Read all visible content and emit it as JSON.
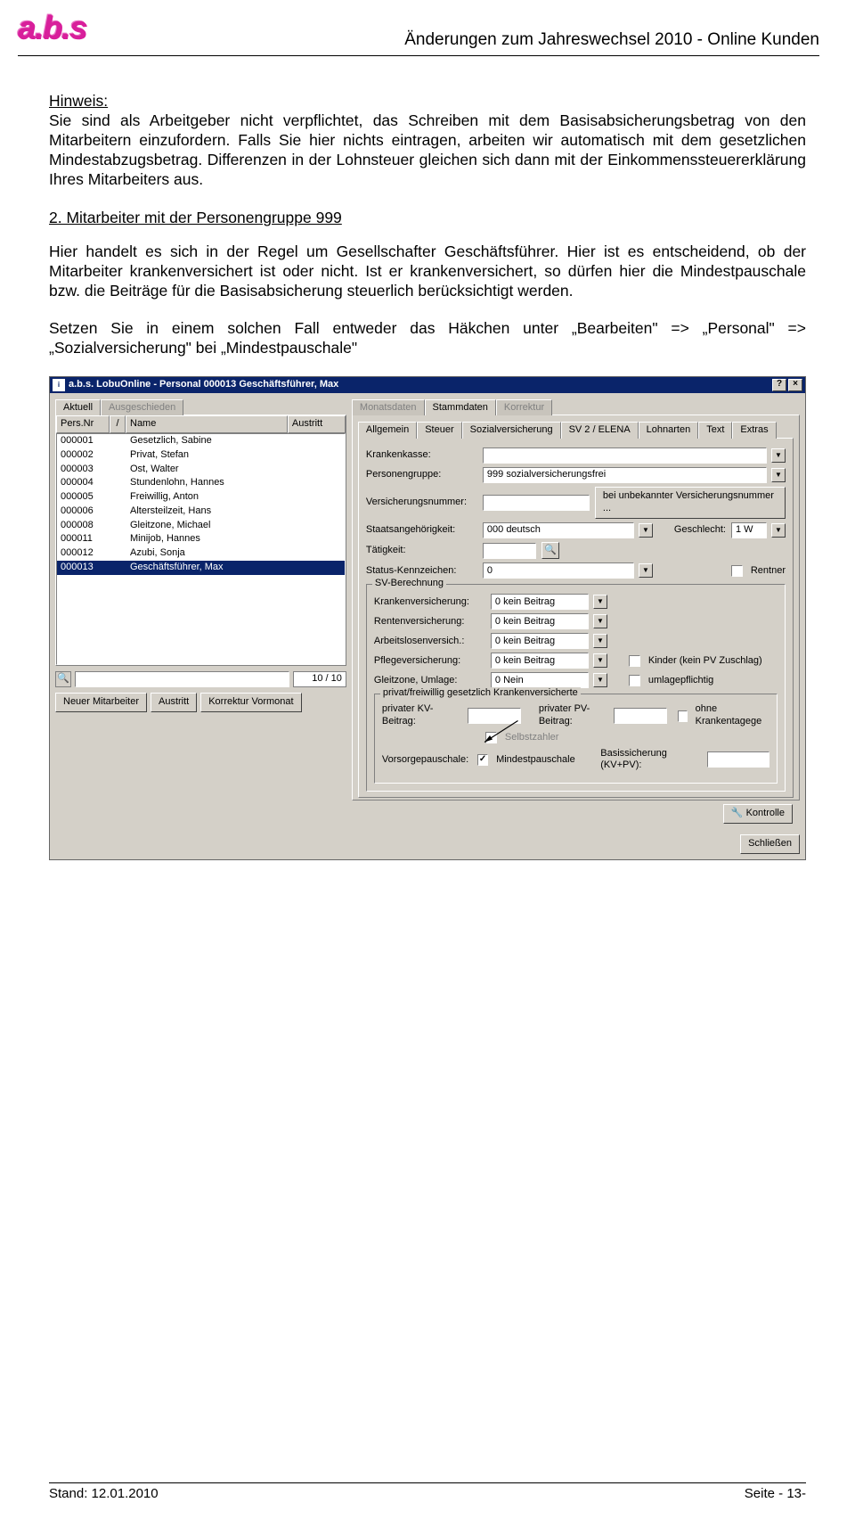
{
  "header": {
    "logo_text": "a.b.s",
    "title": "Änderungen zum Jahreswechsel 2010 - Online Kunden"
  },
  "hinweis": {
    "label": "Hinweis:",
    "text": "Sie sind als Arbeitgeber nicht verpflichtet, das Schreiben mit dem Basisabsicherungsbetrag von den Mitarbeitern einzufordern. Falls Sie hier nichts eintragen, arbeiten wir automatisch mit dem gesetzlichen Mindestabzugsbetrag. Differenzen in der Lohnsteuer gleichen sich dann mit der Einkommenssteuererklärung Ihres Mitarbeiters aus."
  },
  "section2": {
    "title": "2. Mitarbeiter mit der Personengruppe 999",
    "p1": "Hier handelt es sich in der Regel um Gesellschafter Geschäftsführer. Hier ist es entscheidend, ob der Mitarbeiter krankenversichert ist oder nicht. Ist er krankenversichert, so dürfen hier die Mindestpauschale bzw. die Beiträge für die Basisabsicherung steuerlich berücksichtigt werden.",
    "p2": "Setzen Sie in einem solchen Fall entweder das Häkchen unter „Bearbeiten\" => „Personal\" => „Sozialversicherung\" bei „Mindestpauschale\""
  },
  "app": {
    "title": "a.b.s. LobuOnline - Personal 000013 Geschäftsführer, Max",
    "help_btn": "?",
    "close_btn": "×",
    "left_tabs": {
      "aktuell": "Aktuell",
      "ausgeschieden": "Ausgeschieden"
    },
    "list": {
      "col_persnr": "Pers.Nr",
      "col_sort": "/",
      "col_name": "Name",
      "col_austritt": "Austritt",
      "rows": [
        {
          "nr": "000001",
          "name": "Gesetzlich, Sabine"
        },
        {
          "nr": "000002",
          "name": "Privat, Stefan"
        },
        {
          "nr": "000003",
          "name": "Ost, Walter"
        },
        {
          "nr": "000004",
          "name": "Stundenlohn, Hannes"
        },
        {
          "nr": "000005",
          "name": "Freiwillig, Anton"
        },
        {
          "nr": "000006",
          "name": "Altersteilzeit, Hans"
        },
        {
          "nr": "000008",
          "name": "Gleitzone, Michael"
        },
        {
          "nr": "000011",
          "name": "Minijob, Hannes"
        },
        {
          "nr": "000012",
          "name": "Azubi, Sonja"
        },
        {
          "nr": "000013",
          "name": "Geschäftsführer, Max"
        }
      ],
      "count": "10 / 10"
    },
    "left_buttons": {
      "neu": "Neuer Mitarbeiter",
      "austritt": "Austritt",
      "korrektur": "Korrektur Vormonat"
    },
    "top_tabs": {
      "monatsdaten": "Monatsdaten",
      "stammdaten": "Stammdaten",
      "korrektur": "Korrektur"
    },
    "sub_tabs": {
      "allgemein": "Allgemein",
      "steuer": "Steuer",
      "sozial": "Sozialversicherung",
      "sv2": "SV 2 / ELENA",
      "lohnarten": "Lohnarten",
      "text": "Text",
      "extras": "Extras"
    },
    "form": {
      "krankenkasse_label": "Krankenkasse:",
      "krankenkasse_value": "",
      "personengruppe_label": "Personengruppe:",
      "personengruppe_value": "999 sozialversicherungsfrei",
      "versnr_label": "Versicherungsnummer:",
      "versnr_value": "",
      "versnr_btn": "bei unbekannter Versicherungsnummer ...",
      "staat_label": "Staatsangehörigkeit:",
      "staat_value": "000 deutsch",
      "geschlecht_label": "Geschlecht:",
      "geschlecht_value": "1 W",
      "taetigkeit_label": "Tätigkeit:",
      "taetigkeit_value": "",
      "status_label": "Status-Kennzeichen:",
      "status_value": "0",
      "rentner_label": "Rentner",
      "sv_berechnung": "SV-Berechnung",
      "kv_label": "Krankenversicherung:",
      "kv_value": "0 kein Beitrag",
      "rv_label": "Rentenversicherung:",
      "rv_value": "0 kein Beitrag",
      "av_label": "Arbeitslosenversich.:",
      "av_value": "0 kein Beitrag",
      "pv_label": "Pflegeversicherung:",
      "pv_value": "0 kein Beitrag",
      "kinder_label": "Kinder (kein PV Zuschlag)",
      "gleit_label": "Gleitzone, Umlage:",
      "gleit_value": "0 Nein",
      "umlage_label": "umlagepflichtig",
      "privat_legend": "privat/freiwillig gesetzlich Krankenversicherte",
      "pkv_label": "privater KV-Beitrag:",
      "ppv_label": "privater PV-Beitrag:",
      "ohne_kt_label": "ohne Krankentagege",
      "selbst_label": "Selbstzahler",
      "vorsorge_label": "Vorsorgepauschale:",
      "mindest_label": "Mindestpauschale",
      "basis_label": "Basissicherung (KV+PV):"
    },
    "kontrolle_btn": "Kontrolle",
    "schliessen_btn": "Schließen"
  },
  "footer": {
    "stand": "Stand: 12.01.2010",
    "seite": "Seite - 13-"
  }
}
